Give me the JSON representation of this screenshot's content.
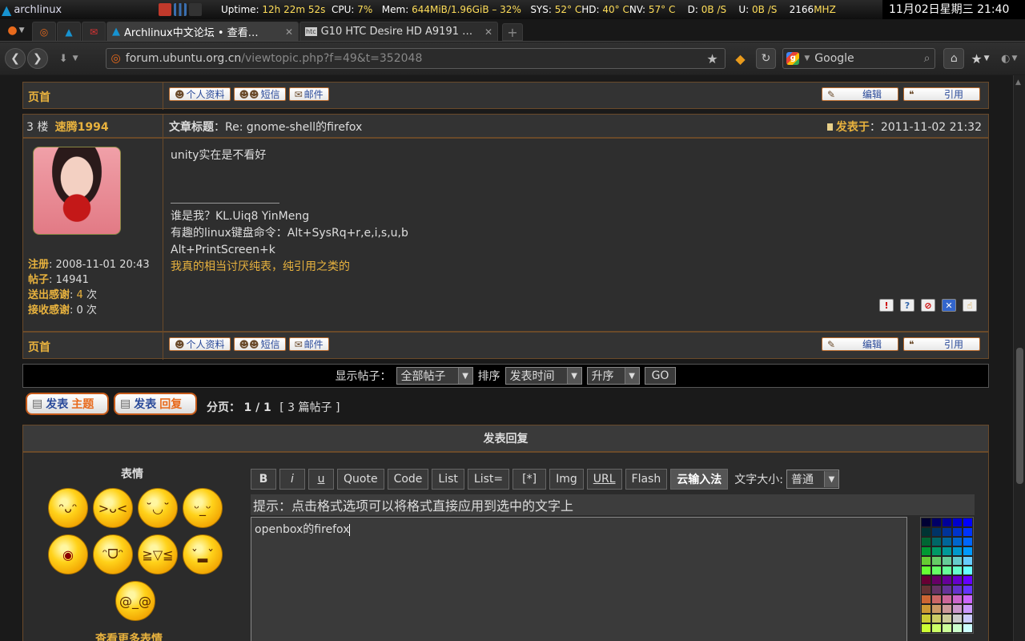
{
  "panel": {
    "os": "archlinux",
    "uptime_label": "Uptime:",
    "uptime": "12h 22m 52s",
    "cpu_label": "CPU:",
    "cpu": "7%",
    "mem_label": "Mem:",
    "mem": "644MiB/1.96GiB – 32%",
    "sys_label": "SYS:",
    "sys": "52° C",
    "hd_label": "HD:",
    "hd": "40° C",
    "nv_label": "NV:",
    "nv": "57° C",
    "d_label": "D:",
    "d": "0B /S",
    "u_label": "U:",
    "u": "0B /S",
    "mhz": "2166",
    "mhz_unit": "MHZ",
    "clock": "11月02日星期三 21:40"
  },
  "tabs": [
    {
      "label": "Archlinux中文论坛 • 查看…",
      "active": true
    },
    {
      "label": "G10 HTC Desire HD A9191 …",
      "active": false
    }
  ],
  "url": {
    "host": "forum.ubuntu.org.cn",
    "path": "/viewtopic.php?f=49&t=352048"
  },
  "search": {
    "placeholder": "Google"
  },
  "post": {
    "top_label": "页首",
    "buttons": {
      "profile": "个人资料",
      "pm": "短信",
      "email": "邮件",
      "edit": "编辑",
      "quote": "引用"
    },
    "floor": "3 楼",
    "author": "速腾1994",
    "title_label": "文章标题",
    "title": "：Re: gnome-shell的firefox",
    "posted_label": "发表于",
    "posted": "：2011-11-02 21:32",
    "reg_label": "注册",
    "reg": ": 2008-11-01 20:43",
    "posts_label": "帖子",
    "posts": ": 14941",
    "sent_label": "送出感谢",
    "sent_pre": ": ",
    "sent_num": "4",
    "sent_suf": " 次",
    "recv_label": "接收感谢",
    "recv": ": 0 次",
    "body": "unity实在是不看好",
    "sig1": "谁是我？KL.Uiq8 YinMeng",
    "sig2": "有趣的linux键盘命令：Alt+SysRq+r,e,i,s,u,b",
    "sig3": "Alt+PrintScreen+k",
    "sig4": "我真的相当讨厌纯表，纯引用之类的"
  },
  "bottom_label": "页首",
  "display": {
    "label": "显示帖子：",
    "all": "全部帖子",
    "sort_label": "排序",
    "sort": "发表时间",
    "order": "升序",
    "go": "GO"
  },
  "actions": {
    "new_topic_a": "发表",
    "new_topic_b": "主题",
    "reply_a": "发表",
    "reply_b": "回复"
  },
  "pagination": {
    "label": "分页：",
    "pages": "1 / 1",
    "count": "[ 3 篇帖子 ]"
  },
  "reply": {
    "header": "发表回复",
    "smilies_label": "表情",
    "more_smilies": "查看更多表情",
    "toolbar": [
      "B",
      "i",
      "u",
      "Quote",
      "Code",
      "List",
      "List=",
      "[*]",
      "Img",
      "URL",
      "Flash"
    ],
    "cloud_ime": "云输入法",
    "font_size_label": "文字大小:",
    "font_size": "普通",
    "hint": "提示：点击格式选项可以将格式直接应用到选中的文字上",
    "text": "openbox的firefox"
  }
}
